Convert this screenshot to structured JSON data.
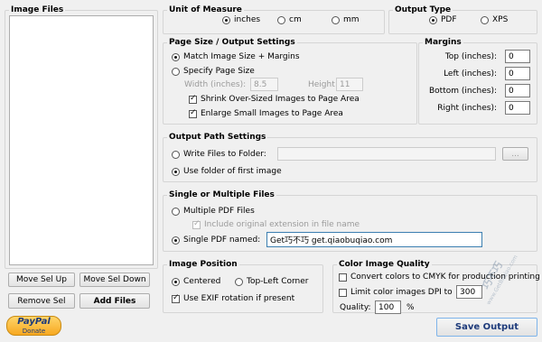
{
  "image_files": {
    "title": "Image Files"
  },
  "buttons": {
    "move_up": "Move Sel Up",
    "move_down": "Move Sel Down",
    "remove": "Remove Sel",
    "add_files": "Add Files",
    "save_output": "Save Output",
    "browse": "..."
  },
  "paypal": {
    "logo": "PayPal",
    "sub": "Donate"
  },
  "unit": {
    "title": "Unit of Measure",
    "options": [
      "inches",
      "cm",
      "mm"
    ],
    "selected": "inches"
  },
  "output_type": {
    "title": "Output Type",
    "options": [
      "PDF",
      "XPS"
    ],
    "selected": "PDF"
  },
  "page_size": {
    "title": "Page Size / Output Settings",
    "match": "Match Image Size + Margins",
    "specify": "Specify Page Size",
    "width_label": "Width (inches):",
    "width_value": "8.5",
    "height_label": "Height",
    "height_value": "11",
    "shrink": "Shrink Over-Sized Images to Page Area",
    "enlarge": "Enlarge Small Images to Page Area"
  },
  "margins": {
    "title": "Margins",
    "top_label": "Top (inches):",
    "top": "0",
    "left_label": "Left (inches):",
    "left": "0",
    "bottom_label": "Bottom (inches):",
    "bottom": "0",
    "right_label": "Right (inches):",
    "right": "0"
  },
  "output_path": {
    "title": "Output Path Settings",
    "write": "Write Files to Folder:",
    "folder_value": "",
    "use_first": "Use folder of first image"
  },
  "single_multi": {
    "title": "Single or Multiple Files",
    "multiple": "Multiple PDF Files",
    "include_ext": "Include original extension in file name",
    "single": "Single PDF named:",
    "single_name": "Get巧不巧 get.qiaobuqiao.com"
  },
  "image_position": {
    "title": "Image Position",
    "centered": "Centered",
    "top_left": "Top-Left Corner",
    "exif": "Use EXIF rotation if present"
  },
  "color_quality": {
    "title": "Color Image Quality",
    "cmyk": "Convert colors to CMYK for production printing",
    "limit_dpi": "Limit color images DPI to",
    "dpi_value": "300",
    "quality_label": "Quality:",
    "quality_value": "100",
    "quality_unit": "%"
  },
  "watermark": {
    "text": "巧不巧",
    "sub": "www.GetBuqiao.com"
  }
}
